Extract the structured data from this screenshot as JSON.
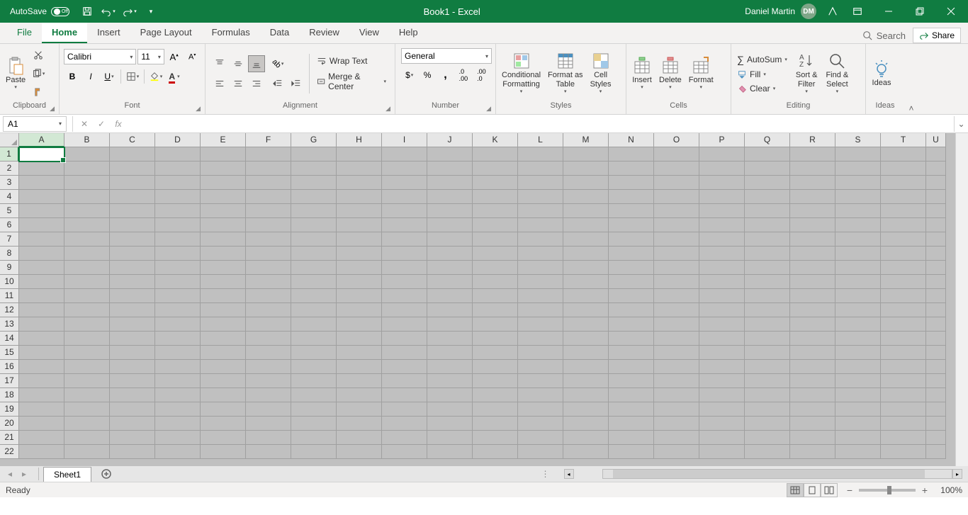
{
  "titlebar": {
    "autosave_label": "AutoSave",
    "autosave_state": "Off",
    "doc_title": "Book1 - Excel",
    "user_name": "Daniel Martin",
    "user_initials": "DM"
  },
  "tabs": {
    "file": "File",
    "items": [
      "Home",
      "Insert",
      "Page Layout",
      "Formulas",
      "Data",
      "Review",
      "View",
      "Help"
    ],
    "active_index": 0,
    "search_placeholder": "Search",
    "share": "Share"
  },
  "ribbon": {
    "clipboard": {
      "label": "Clipboard",
      "paste": "Paste"
    },
    "font": {
      "label": "Font",
      "name": "Calibri",
      "size": "11"
    },
    "alignment": {
      "label": "Alignment",
      "wrap": "Wrap Text",
      "merge": "Merge & Center"
    },
    "number": {
      "label": "Number",
      "format": "General"
    },
    "styles": {
      "label": "Styles",
      "conditional": "Conditional Formatting",
      "fat": "Format as Table",
      "cell": "Cell Styles"
    },
    "cells": {
      "label": "Cells",
      "insert": "Insert",
      "delete": "Delete",
      "format": "Format"
    },
    "editing": {
      "label": "Editing",
      "autosum": "AutoSum",
      "fill": "Fill",
      "clear": "Clear",
      "sort": "Sort & Filter",
      "find": "Find & Select"
    },
    "ideas": {
      "label": "Ideas",
      "ideas": "Ideas"
    }
  },
  "formula_bar": {
    "name_box": "A1",
    "formula": ""
  },
  "grid": {
    "columns": [
      "A",
      "B",
      "C",
      "D",
      "E",
      "F",
      "G",
      "H",
      "I",
      "J",
      "K",
      "L",
      "M",
      "N",
      "O",
      "P",
      "Q",
      "R",
      "S",
      "T",
      "U"
    ],
    "rows": [
      1,
      2,
      3,
      4,
      5,
      6,
      7,
      8,
      9,
      10,
      11,
      12,
      13,
      14,
      15,
      16,
      17,
      18,
      19,
      20,
      21,
      22
    ],
    "active_cell": "A1"
  },
  "sheets": {
    "tabs": [
      "Sheet1"
    ],
    "active_index": 0
  },
  "status": {
    "state": "Ready",
    "zoom": "100%"
  }
}
